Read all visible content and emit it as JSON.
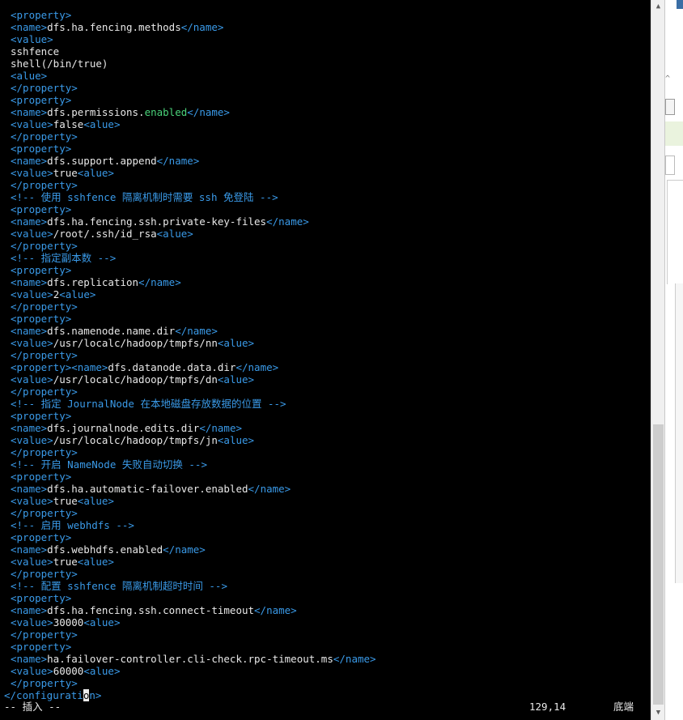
{
  "lines": [
    {
      "indent": true,
      "segments": [
        {
          "t": "t",
          "s": "<property>"
        }
      ]
    },
    {
      "indent": true,
      "segments": [
        {
          "t": "t",
          "s": "<name>"
        },
        {
          "t": "x",
          "s": "dfs.ha.fencing.methods"
        },
        {
          "t": "t",
          "s": "</name>"
        }
      ]
    },
    {
      "indent": true,
      "segments": [
        {
          "t": "t",
          "s": "<value>"
        }
      ]
    },
    {
      "indent": true,
      "segments": [
        {
          "t": "x",
          "s": "sshfence"
        }
      ]
    },
    {
      "indent": true,
      "segments": [
        {
          "t": "x",
          "s": "shell(/bin/true)"
        }
      ]
    },
    {
      "indent": true,
      "segments": [
        {
          "t": "t",
          "s": "<alue>"
        }
      ]
    },
    {
      "indent": true,
      "segments": [
        {
          "t": "t",
          "s": "</property>"
        }
      ]
    },
    {
      "indent": true,
      "segments": [
        {
          "t": "t",
          "s": "<property>"
        }
      ]
    },
    {
      "indent": true,
      "segments": [
        {
          "t": "t",
          "s": "<name>"
        },
        {
          "t": "x",
          "s": "dfs.permissions."
        },
        {
          "t": "k",
          "s": "enabled"
        },
        {
          "t": "t",
          "s": "</name>"
        }
      ]
    },
    {
      "indent": true,
      "segments": [
        {
          "t": "t",
          "s": "<value>"
        },
        {
          "t": "x",
          "s": "false"
        },
        {
          "t": "t",
          "s": "<alue>"
        }
      ]
    },
    {
      "indent": true,
      "segments": [
        {
          "t": "t",
          "s": "</property>"
        }
      ]
    },
    {
      "indent": true,
      "segments": [
        {
          "t": "t",
          "s": "<property>"
        }
      ]
    },
    {
      "indent": true,
      "segments": [
        {
          "t": "t",
          "s": "<name>"
        },
        {
          "t": "x",
          "s": "dfs.support.append"
        },
        {
          "t": "t",
          "s": "</name>"
        }
      ]
    },
    {
      "indent": true,
      "segments": [
        {
          "t": "t",
          "s": "<value>"
        },
        {
          "t": "x",
          "s": "true"
        },
        {
          "t": "t",
          "s": "<alue>"
        }
      ]
    },
    {
      "indent": true,
      "segments": [
        {
          "t": "t",
          "s": "</property>"
        }
      ]
    },
    {
      "indent": true,
      "segments": [
        {
          "t": "c",
          "s": "<!-- 使用 sshfence 隔离机制时需要 ssh 免登陆 -->"
        }
      ]
    },
    {
      "indent": true,
      "segments": [
        {
          "t": "t",
          "s": "<property>"
        }
      ]
    },
    {
      "indent": true,
      "segments": [
        {
          "t": "t",
          "s": "<name>"
        },
        {
          "t": "x",
          "s": "dfs.ha.fencing.ssh.private-key-files"
        },
        {
          "t": "t",
          "s": "</name>"
        }
      ]
    },
    {
      "indent": true,
      "segments": [
        {
          "t": "t",
          "s": "<value>"
        },
        {
          "t": "x",
          "s": "/root/.ssh/id_rsa"
        },
        {
          "t": "t",
          "s": "<alue>"
        }
      ]
    },
    {
      "indent": true,
      "segments": [
        {
          "t": "t",
          "s": "</property>"
        }
      ]
    },
    {
      "indent": true,
      "segments": [
        {
          "t": "c",
          "s": "<!-- 指定副本数 -->"
        }
      ]
    },
    {
      "indent": true,
      "segments": [
        {
          "t": "t",
          "s": "<property>"
        }
      ]
    },
    {
      "indent": true,
      "segments": [
        {
          "t": "t",
          "s": "<name>"
        },
        {
          "t": "x",
          "s": "dfs.replication"
        },
        {
          "t": "t",
          "s": "</name>"
        }
      ]
    },
    {
      "indent": true,
      "segments": [
        {
          "t": "t",
          "s": "<value>"
        },
        {
          "t": "x",
          "s": "2"
        },
        {
          "t": "t",
          "s": "<alue>"
        }
      ]
    },
    {
      "indent": true,
      "segments": [
        {
          "t": "t",
          "s": "</property>"
        }
      ]
    },
    {
      "indent": true,
      "segments": [
        {
          "t": "t",
          "s": "<property>"
        }
      ]
    },
    {
      "indent": true,
      "segments": [
        {
          "t": "t",
          "s": "<name>"
        },
        {
          "t": "x",
          "s": "dfs.namenode.name.dir"
        },
        {
          "t": "t",
          "s": "</name>"
        }
      ]
    },
    {
      "indent": true,
      "segments": [
        {
          "t": "t",
          "s": "<value>"
        },
        {
          "t": "x",
          "s": "/usr/localc/hadoop/tmpfs/nn"
        },
        {
          "t": "t",
          "s": "<alue>"
        }
      ]
    },
    {
      "indent": true,
      "segments": [
        {
          "t": "t",
          "s": "</property>"
        }
      ]
    },
    {
      "indent": true,
      "segments": [
        {
          "t": "t",
          "s": "<property><name>"
        },
        {
          "t": "x",
          "s": "dfs.datanode.data.dir"
        },
        {
          "t": "t",
          "s": "</name>"
        }
      ]
    },
    {
      "indent": true,
      "segments": [
        {
          "t": "t",
          "s": "<value>"
        },
        {
          "t": "x",
          "s": "/usr/localc/hadoop/tmpfs/dn"
        },
        {
          "t": "t",
          "s": "<alue>"
        }
      ]
    },
    {
      "indent": true,
      "segments": [
        {
          "t": "t",
          "s": "</property>"
        }
      ]
    },
    {
      "indent": true,
      "segments": [
        {
          "t": "c",
          "s": "<!-- 指定 JournalNode 在本地磁盘存放数据的位置 -->"
        }
      ]
    },
    {
      "indent": true,
      "segments": [
        {
          "t": "t",
          "s": "<property>"
        }
      ]
    },
    {
      "indent": true,
      "segments": [
        {
          "t": "t",
          "s": "<name>"
        },
        {
          "t": "x",
          "s": "dfs.journalnode.edits.dir"
        },
        {
          "t": "t",
          "s": "</name>"
        }
      ]
    },
    {
      "indent": true,
      "segments": [
        {
          "t": "t",
          "s": "<value>"
        },
        {
          "t": "x",
          "s": "/usr/localc/hadoop/tmpfs/jn"
        },
        {
          "t": "t",
          "s": "<alue>"
        }
      ]
    },
    {
      "indent": true,
      "segments": [
        {
          "t": "t",
          "s": "</property>"
        }
      ]
    },
    {
      "indent": true,
      "segments": [
        {
          "t": "c",
          "s": "<!-- 开启 NameNode 失败自动切换 -->"
        }
      ]
    },
    {
      "indent": true,
      "segments": [
        {
          "t": "t",
          "s": "<property>"
        }
      ]
    },
    {
      "indent": true,
      "segments": [
        {
          "t": "t",
          "s": "<name>"
        },
        {
          "t": "x",
          "s": "dfs.ha.automatic-failover.enabled"
        },
        {
          "t": "t",
          "s": "</name>"
        }
      ]
    },
    {
      "indent": true,
      "segments": [
        {
          "t": "t",
          "s": "<value>"
        },
        {
          "t": "x",
          "s": "true"
        },
        {
          "t": "t",
          "s": "<alue>"
        }
      ]
    },
    {
      "indent": true,
      "segments": [
        {
          "t": "t",
          "s": "</property>"
        }
      ]
    },
    {
      "indent": true,
      "segments": [
        {
          "t": "c",
          "s": "<!-- 启用 webhdfs -->"
        }
      ]
    },
    {
      "indent": true,
      "segments": [
        {
          "t": "t",
          "s": "<property>"
        }
      ]
    },
    {
      "indent": true,
      "segments": [
        {
          "t": "t",
          "s": "<name>"
        },
        {
          "t": "x",
          "s": "dfs.webhdfs.enabled"
        },
        {
          "t": "t",
          "s": "</name>"
        }
      ]
    },
    {
      "indent": true,
      "segments": [
        {
          "t": "t",
          "s": "<value>"
        },
        {
          "t": "x",
          "s": "true"
        },
        {
          "t": "t",
          "s": "<alue>"
        }
      ]
    },
    {
      "indent": true,
      "segments": [
        {
          "t": "t",
          "s": "</property>"
        }
      ]
    },
    {
      "indent": true,
      "segments": [
        {
          "t": "c",
          "s": "<!-- 配置 sshfence 隔离机制超时时间 -->"
        }
      ]
    },
    {
      "indent": true,
      "segments": [
        {
          "t": "t",
          "s": "<property>"
        }
      ]
    },
    {
      "indent": true,
      "segments": [
        {
          "t": "t",
          "s": "<name>"
        },
        {
          "t": "x",
          "s": "dfs.ha.fencing.ssh.connect-timeout"
        },
        {
          "t": "t",
          "s": "</name>"
        }
      ]
    },
    {
      "indent": true,
      "segments": [
        {
          "t": "t",
          "s": "<value>"
        },
        {
          "t": "x",
          "s": "30000"
        },
        {
          "t": "t",
          "s": "<alue>"
        }
      ]
    },
    {
      "indent": true,
      "segments": [
        {
          "t": "t",
          "s": "</property>"
        }
      ]
    },
    {
      "indent": true,
      "segments": [
        {
          "t": "t",
          "s": "<property>"
        }
      ]
    },
    {
      "indent": true,
      "segments": [
        {
          "t": "t",
          "s": "<name>"
        },
        {
          "t": "x",
          "s": "ha.failover-controller.cli-check.rpc-timeout.ms"
        },
        {
          "t": "t",
          "s": "</name>"
        }
      ]
    },
    {
      "indent": true,
      "segments": [
        {
          "t": "t",
          "s": "<value>"
        },
        {
          "t": "x",
          "s": "60000"
        },
        {
          "t": "t",
          "s": "<alue>"
        }
      ]
    },
    {
      "indent": true,
      "segments": [
        {
          "t": "t",
          "s": "</property>"
        }
      ]
    },
    {
      "indent": false,
      "segments": [
        {
          "t": "t",
          "s": "</configurati"
        },
        {
          "t": "cursor",
          "s": "o"
        },
        {
          "t": "t",
          "s": "n>"
        }
      ]
    }
  ],
  "status": {
    "mode": "-- 插入 --",
    "position": "129,14",
    "scroll": "底端"
  },
  "scrollbar": {
    "up_icon": "▲",
    "down_icon": "▼"
  },
  "colors": {
    "background": "#000000",
    "tag": "#3a9ae8",
    "text": "#e8e8e8",
    "keyword": "#4ad37a"
  }
}
